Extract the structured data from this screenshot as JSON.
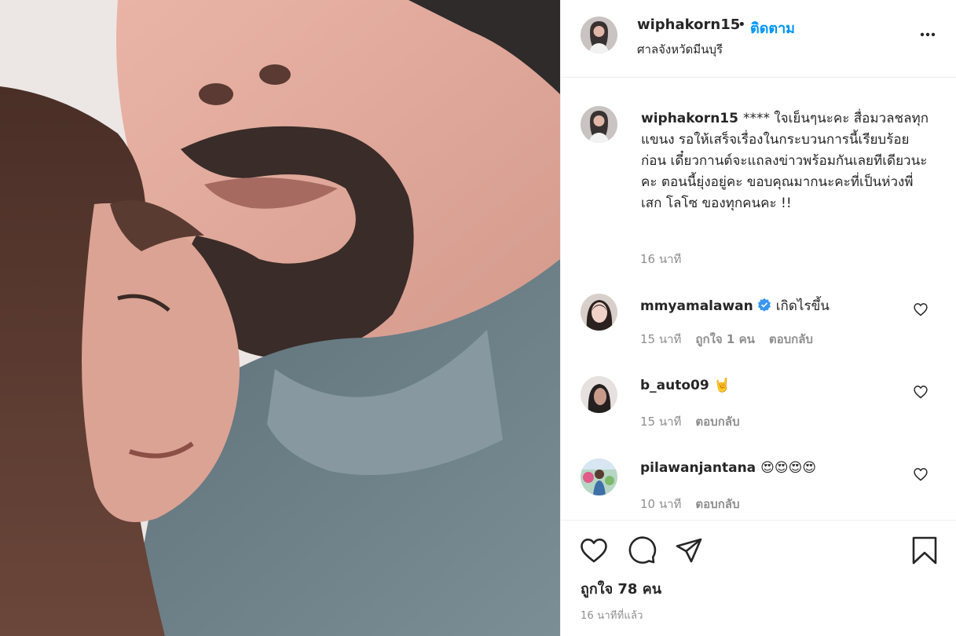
{
  "post": {
    "username": "wiphakorn15",
    "separator": "•",
    "follow_label": "ติดตาม",
    "location": "ศาลจังหวัดมีนบุรี",
    "caption": "**** ใจเย็นๆนะคะ สื่อมวลชลทุกแขนง รอให้เสร็จเรื่องในกระบวนการนี้เรียบร้อยก่อน เดี๋ยวกานต์จะแถลงข่าวพร้อมกันเลยทีเดียวนะคะ ตอนนี้ยุ่งอยู่คะ ขอบคุณมากนะคะที่เป็นห่วงพี่เสก โลโซ ของทุกคนคะ !!",
    "caption_time": "16 นาที",
    "likes_text": "ถูกใจ 78 คน",
    "time_ago": "16 นาทีที่แล้ว"
  },
  "comments": [
    {
      "username": "mmyamalawan",
      "verified": true,
      "text": "เกิดไรขึ้น",
      "time": "15 นาที",
      "likes": "ถูกใจ 1 คน",
      "reply": "ตอบกลับ"
    },
    {
      "username": "b_auto09",
      "verified": false,
      "text": "🤘",
      "time": "15 นาที",
      "likes": "",
      "reply": "ตอบกลับ"
    },
    {
      "username": "pilawanjantana",
      "verified": false,
      "text": "😍😍😍😍",
      "time": "10 นาที",
      "likes": "",
      "reply": "ตอบกลับ"
    }
  ],
  "icons": {
    "more": "more-options-icon",
    "like": "heart-icon",
    "comment": "comment-icon",
    "share": "share-icon",
    "save": "bookmark-icon",
    "verified": "verified-badge-icon"
  },
  "colors": {
    "accent": "#0095f6",
    "text": "#262626",
    "muted": "#8e8e8e",
    "border": "#efefef"
  }
}
